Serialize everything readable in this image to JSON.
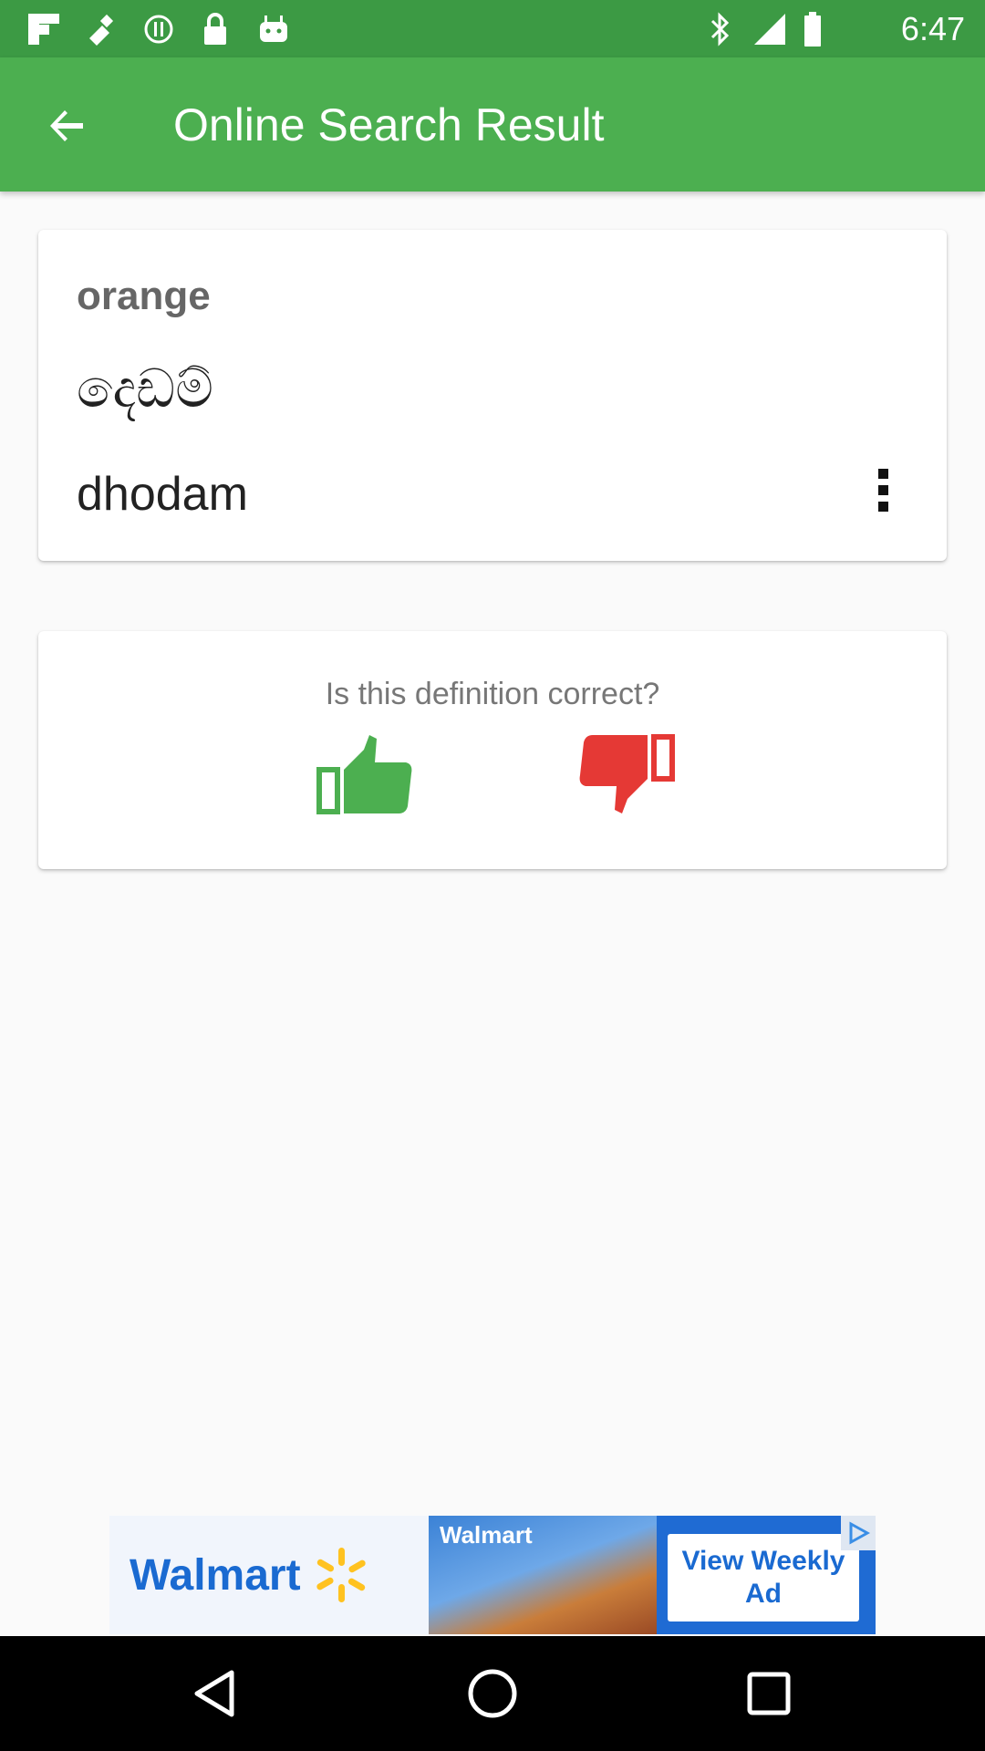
{
  "status_bar": {
    "time": "6:47",
    "icons": [
      "flipboard-icon",
      "fake-gps-icon",
      "sync-icon",
      "lock-icon",
      "android-icon",
      "bluetooth-icon",
      "signal-icon",
      "battery-icon"
    ]
  },
  "app_bar": {
    "title": "Online Search Result",
    "back_icon": "arrow-back-icon"
  },
  "result": {
    "word": "orange",
    "translation": "දෙඩම්",
    "transliteration": "dhodam",
    "menu_icon": "more-vert-icon"
  },
  "feedback": {
    "question": "Is this definition correct?",
    "up_icon": "thumbs-up-icon",
    "down_icon": "thumbs-down-icon",
    "up_color": "#4caf50",
    "down_color": "#e53935"
  },
  "ad": {
    "brand": "Walmart",
    "photo_label": "Walmart",
    "cta": "View Weekly Ad",
    "play_icon": "ad-choices-icon"
  },
  "colors": {
    "app_bar": "#4caf50",
    "status_bar": "#3c9a44",
    "background": "#fafafa"
  }
}
